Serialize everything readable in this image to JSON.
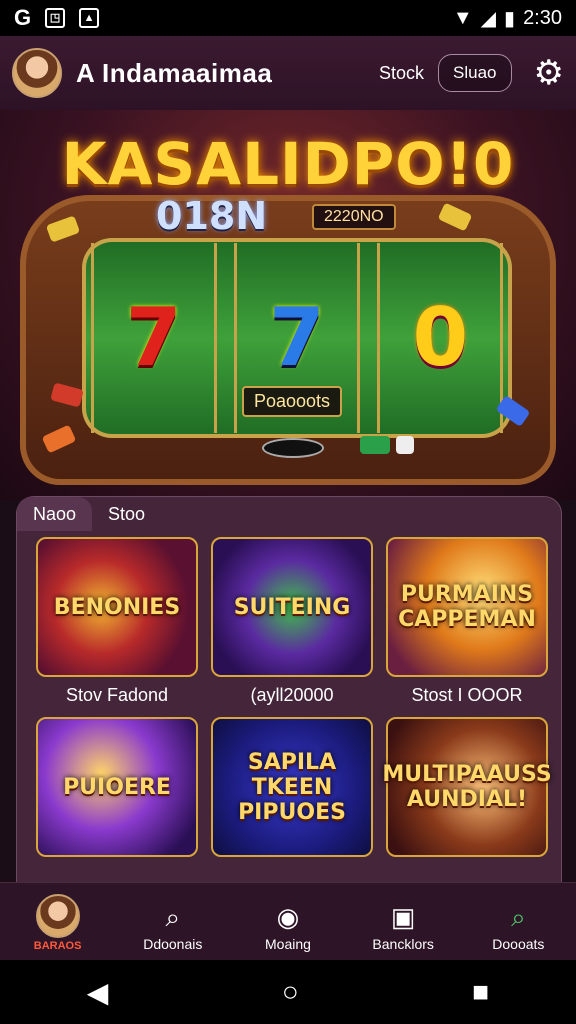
{
  "status_bar": {
    "time": "2:30",
    "left_icons": [
      "sync-icon",
      "image-icon",
      "photo-icon"
    ]
  },
  "app_bar": {
    "title": "A Indamaaimaa",
    "link_label": "Stock",
    "button_label": "Sluao"
  },
  "hero": {
    "title": "KASALIDPO!0",
    "number": "018N",
    "score": "2220NO",
    "reel_label": "Poaooots",
    "reels": [
      "7",
      "7",
      "0"
    ]
  },
  "panel": {
    "tabs": [
      "Naoo",
      "Stoo"
    ],
    "games": [
      {
        "thumb_text": "BENONIES",
        "title": "Stov Fadond"
      },
      {
        "thumb_text": "SUITEING",
        "title": "(ayll20000"
      },
      {
        "thumb_text": "PURMAINS CAPPEMAN",
        "title": "Stost I OOOR"
      },
      {
        "thumb_text": "PUIOERE",
        "title": ""
      },
      {
        "thumb_text": "SAPILA TKEEN PIPUOES",
        "title": ""
      },
      {
        "thumb_text": "MULTIPAAUSS AUNDIAL!",
        "title": ""
      }
    ]
  },
  "bottom_nav": [
    {
      "label": "BARAOS",
      "icon": "avatar"
    },
    {
      "label": "Ddoonais",
      "icon": "search-icon"
    },
    {
      "label": "Moaing",
      "icon": "chat-icon"
    },
    {
      "label": "Bancklors",
      "icon": "wallet-icon"
    },
    {
      "label": "Doooats",
      "icon": "search-icon"
    }
  ],
  "colors": {
    "brand": "#2d1226",
    "accent": "#ffd23a",
    "active_nav": "#4ec46a"
  }
}
